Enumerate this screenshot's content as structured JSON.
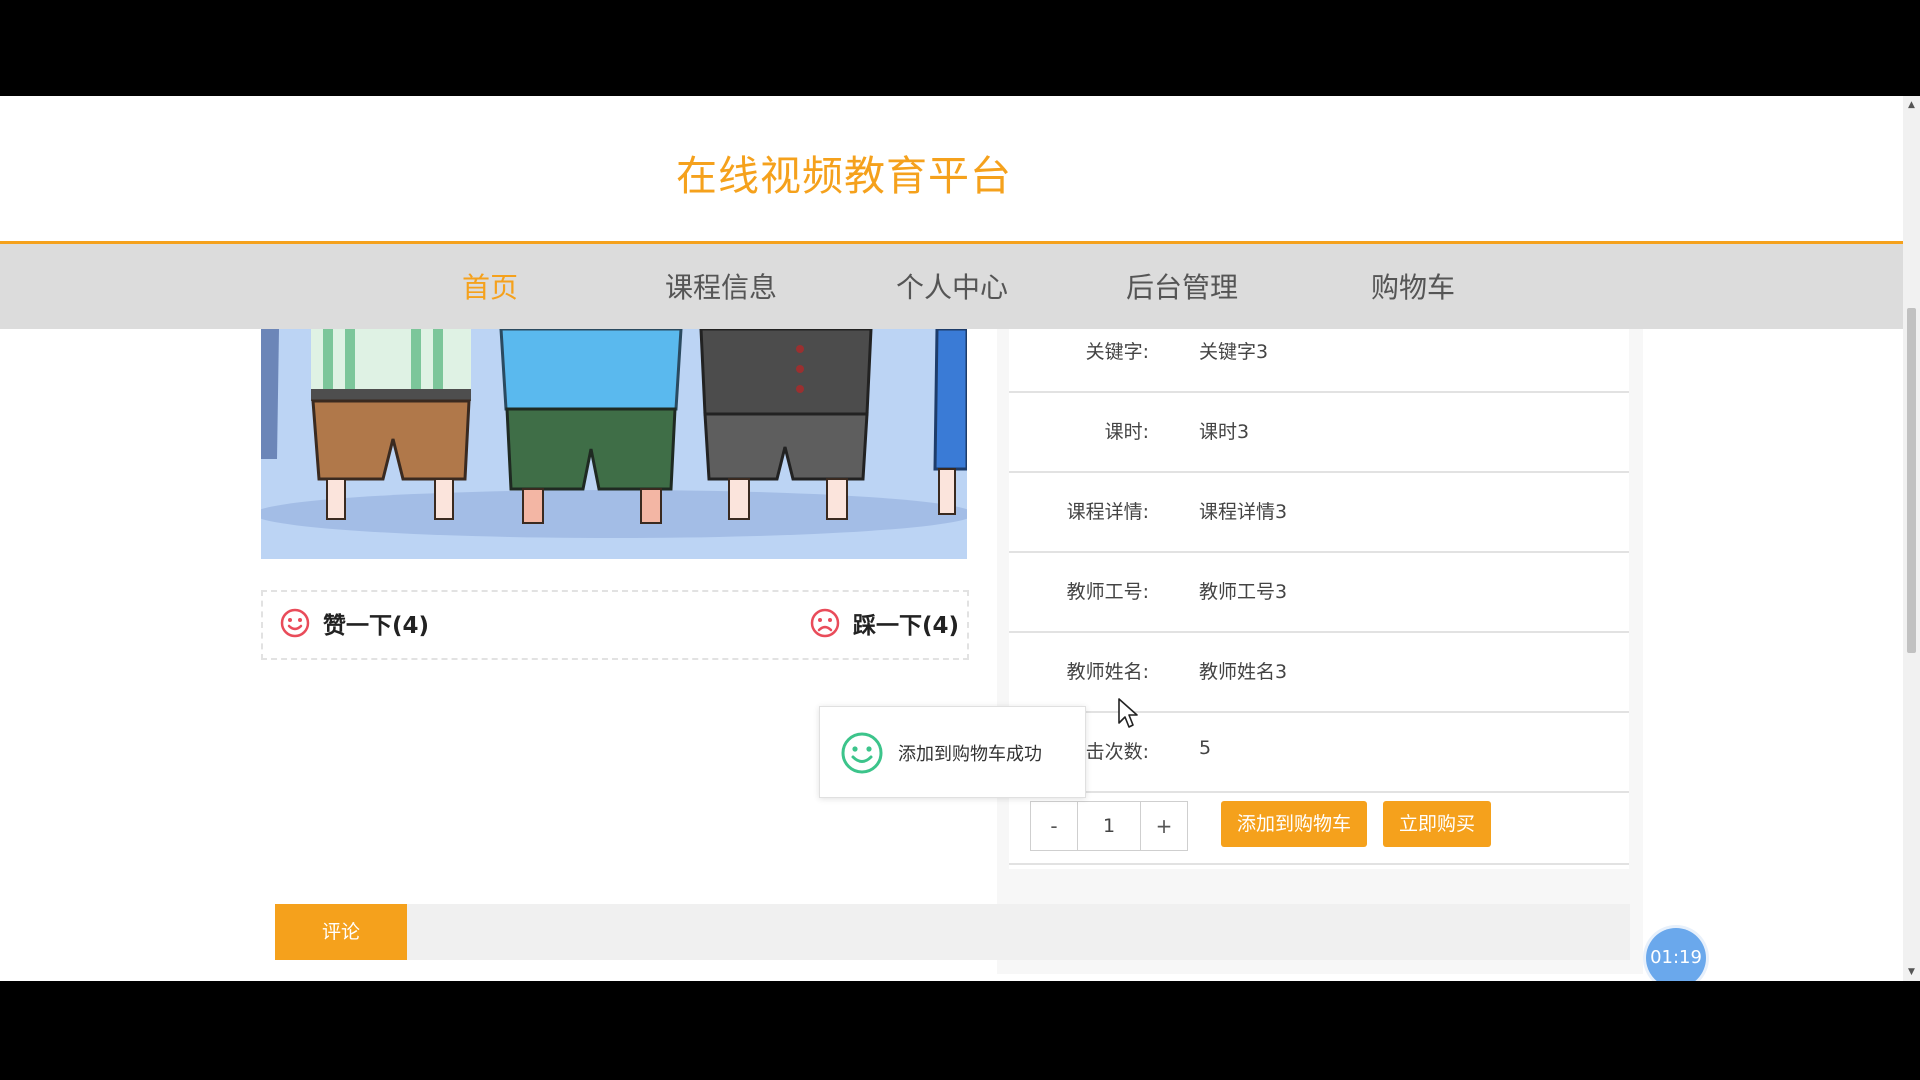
{
  "site": {
    "title": "在线视频教育平台"
  },
  "nav": {
    "items": [
      {
        "label": "首页",
        "active": true
      },
      {
        "label": "课程信息",
        "active": false
      },
      {
        "label": "个人中心",
        "active": false
      },
      {
        "label": "后台管理",
        "active": false
      },
      {
        "label": "购物车",
        "active": false
      }
    ]
  },
  "votes": {
    "like_label": "赞一下(4)",
    "dislike_label": "踩一下(4)"
  },
  "details": [
    {
      "label": "关键字:",
      "value": "关键字3"
    },
    {
      "label": "课时:",
      "value": "课时3"
    },
    {
      "label": "课程详情:",
      "value": "课程详情3"
    },
    {
      "label": "教师工号:",
      "value": "教师工号3"
    },
    {
      "label": "教师姓名:",
      "value": "教师姓名3"
    },
    {
      "label": "点击次数:",
      "value": "5"
    }
  ],
  "purchase": {
    "minus": "-",
    "quantity": "1",
    "plus": "+",
    "add_to_cart_label": "添加到购物车",
    "buy_now_label": "立即购买"
  },
  "toast": {
    "message": "添加到购物车成功"
  },
  "comments": {
    "tab_label": "评论"
  },
  "timer": {
    "time": "01:19"
  },
  "colors": {
    "accent": "#f5a11c",
    "nav_bg": "#dcdcdc",
    "timer_bg": "#6aa8ec",
    "toast_icon": "#3cc48b",
    "vote_icon": "#e94c5a"
  }
}
